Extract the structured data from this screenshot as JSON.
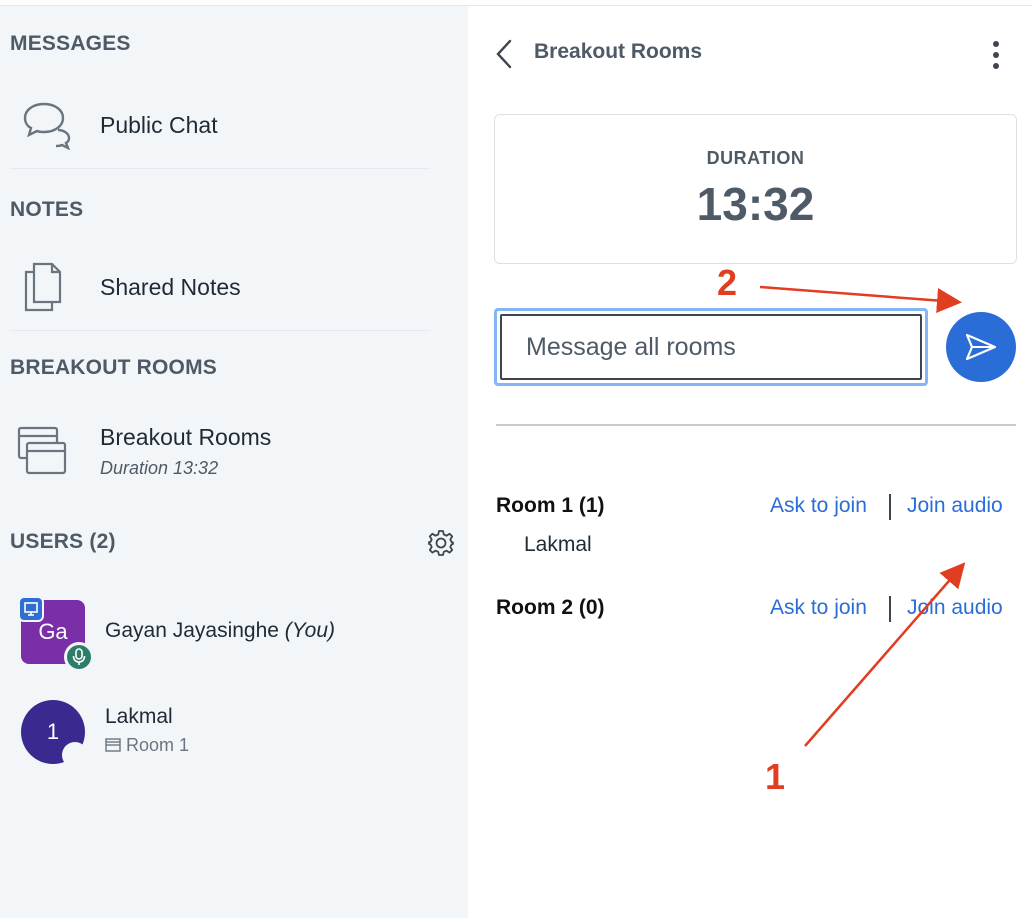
{
  "sidebar": {
    "messages": {
      "title": "MESSAGES",
      "public_chat": "Public Chat"
    },
    "notes": {
      "title": "NOTES",
      "shared_notes": "Shared Notes"
    },
    "breakout": {
      "title": "BREAKOUT ROOMS",
      "label": "Breakout Rooms",
      "duration": "Duration 13:32"
    },
    "users": {
      "title": "USERS (2)",
      "list": [
        {
          "initials": "Ga",
          "name": "Gayan Jayasinghe",
          "suffix": "(You)",
          "color": "#7a2ea7"
        },
        {
          "initials": "1",
          "name": "Lakmal",
          "room": "Room 1",
          "color": "#3a2a8f"
        }
      ]
    }
  },
  "panel": {
    "title": "Breakout Rooms",
    "duration": {
      "label": "DURATION",
      "time": "13:32"
    },
    "message": {
      "placeholder": "Message all rooms"
    },
    "rooms": [
      {
        "title": "Room 1 (1)",
        "members": [
          "Lakmal"
        ],
        "ask": "Ask to join",
        "audio": "Join audio"
      },
      {
        "title": "Room 2 (0)",
        "members": [],
        "ask": "Ask to join",
        "audio": "Join audio"
      }
    ]
  },
  "annotations": {
    "one": "1",
    "two": "2",
    "color": "#e13d20"
  },
  "colors": {
    "accent": "#2b6dd6",
    "sidebar_bg": "#f3f6f9"
  }
}
